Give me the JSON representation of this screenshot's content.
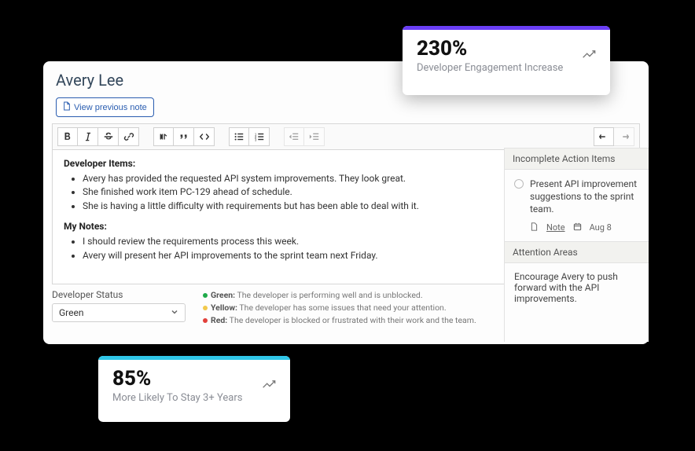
{
  "header": {
    "title": "Avery Lee"
  },
  "buttons": {
    "view_prev_note": "View previous note"
  },
  "editor": {
    "section1_title": "Developer Items:",
    "section1_items": [
      "Avery has provided the requested API system improvements. They look great.",
      "She finished work item PC-129 ahead of schedule.",
      "She is having a little difficulty with requirements but has been able to deal with it."
    ],
    "section2_title": "My Notes:",
    "section2_items": [
      "I should review the requirements process this week.",
      "Avery will present her API improvements to the sprint team next Friday."
    ]
  },
  "status": {
    "label": "Developer Status",
    "selected": "Green",
    "legend": {
      "green_label": "Green:",
      "green_text": " The developer is performing well and is unblocked.",
      "yellow_label": "Yellow:",
      "yellow_text": " The developer has some issues that need your attention.",
      "red_label": "Red:",
      "red_text": " The developer is blocked or frustrated with their work and the team."
    }
  },
  "side": {
    "incomplete_title": "Incomplete Action Items",
    "action_text": "Present API improvement suggestions to the sprint team.",
    "note_link": "Note",
    "date": "Aug 8",
    "attention_title": "Attention Areas",
    "attention_text": "Encourage Avery to push forward with the API improvements."
  },
  "cards": {
    "top": {
      "value": "230%",
      "label": "Developer Engagement Increase",
      "bar_color": "#6a3ef5"
    },
    "bottom": {
      "value": "85%",
      "label": "More Likely To Stay 3+ Years",
      "bar_color": "#2fc6e8"
    }
  }
}
